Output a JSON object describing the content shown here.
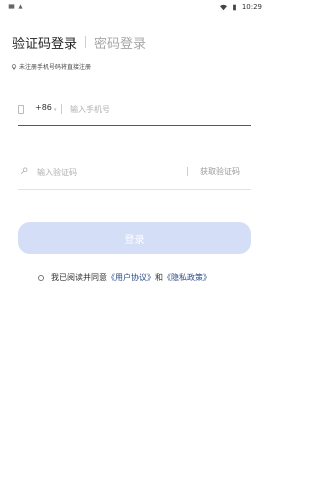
{
  "status_bar": {
    "time": "10:29"
  },
  "tabs": {
    "active": "验证码登录",
    "inactive": "密码登录"
  },
  "notice": "未注册手机号码将直接注册",
  "phone": {
    "country_code": "+86",
    "placeholder": "输入手机号"
  },
  "verification": {
    "placeholder": "输入验证码",
    "get_code": "获取验证码"
  },
  "login_button": "登录",
  "agreement": {
    "prefix": "我已阅读并同意",
    "user_agreement": "《用户协议》",
    "and": "和",
    "privacy_policy": "《隐私政策》"
  },
  "colors": {
    "accent": "#3f5a96",
    "button_bg": "#d4def7",
    "link": "#2d4a8a"
  }
}
